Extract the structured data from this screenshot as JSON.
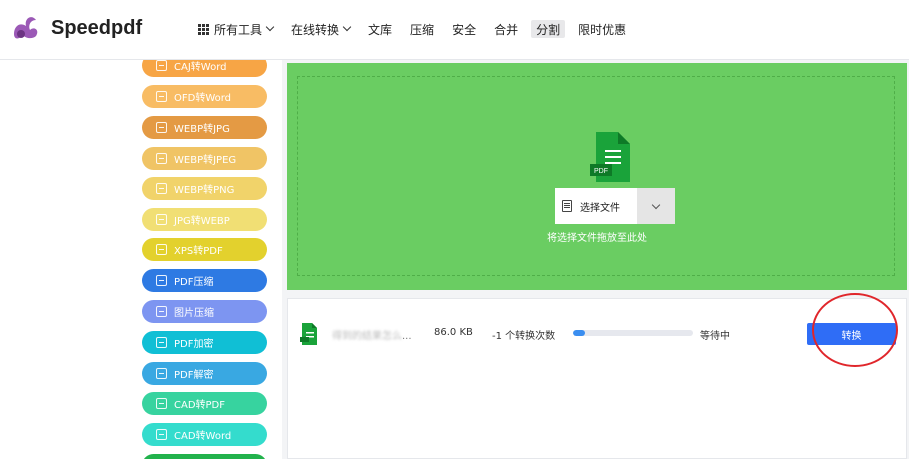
{
  "brand": {
    "name": "Speedpdf"
  },
  "nav": {
    "all_tools": "所有工具",
    "online_convert": "在线转换",
    "library": "文库",
    "compress": "压缩",
    "security": "安全",
    "merge": "合并",
    "split": "分割",
    "promo": "限时优惠"
  },
  "sidebar": {
    "items": [
      {
        "label": "CAJ转Word",
        "color": "#f7a545"
      },
      {
        "label": "OFD转Word",
        "color": "#f8bc64"
      },
      {
        "label": "WEBP转JPG",
        "color": "#e49a44"
      },
      {
        "label": "WEBP转JPEG",
        "color": "#f0c465"
      },
      {
        "label": "WEBP转PNG",
        "color": "#f1d36a"
      },
      {
        "label": "JPG转WEBP",
        "color": "#f1df74"
      },
      {
        "label": "XPS转PDF",
        "color": "#e3d12d"
      },
      {
        "label": "PDF压缩",
        "color": "#2e7ae3"
      },
      {
        "label": "图片压缩",
        "color": "#7d95f1"
      },
      {
        "label": "PDF加密",
        "color": "#10bfd5"
      },
      {
        "label": "PDF解密",
        "color": "#39a8e2"
      },
      {
        "label": "CAD转PDF",
        "color": "#37d39f"
      },
      {
        "label": "CAD转Word",
        "color": "#34dccd"
      },
      {
        "label": "",
        "color": "#22b24c"
      }
    ]
  },
  "upload": {
    "choose_label": "选择文件",
    "drop_hint": "将选择文件拖放至此处",
    "file_type_label": "PDF",
    "bg_color": "#6acd62"
  },
  "queue": {
    "file_name_blurred": "得到的结果怎么",
    "file_name_suffix": "...",
    "file_size": "86.0 KB",
    "convert_count": "-1 个转换次数",
    "progress": 0.1,
    "status": "等待中",
    "convert_button": "转换",
    "button_color": "#2f6df6"
  }
}
